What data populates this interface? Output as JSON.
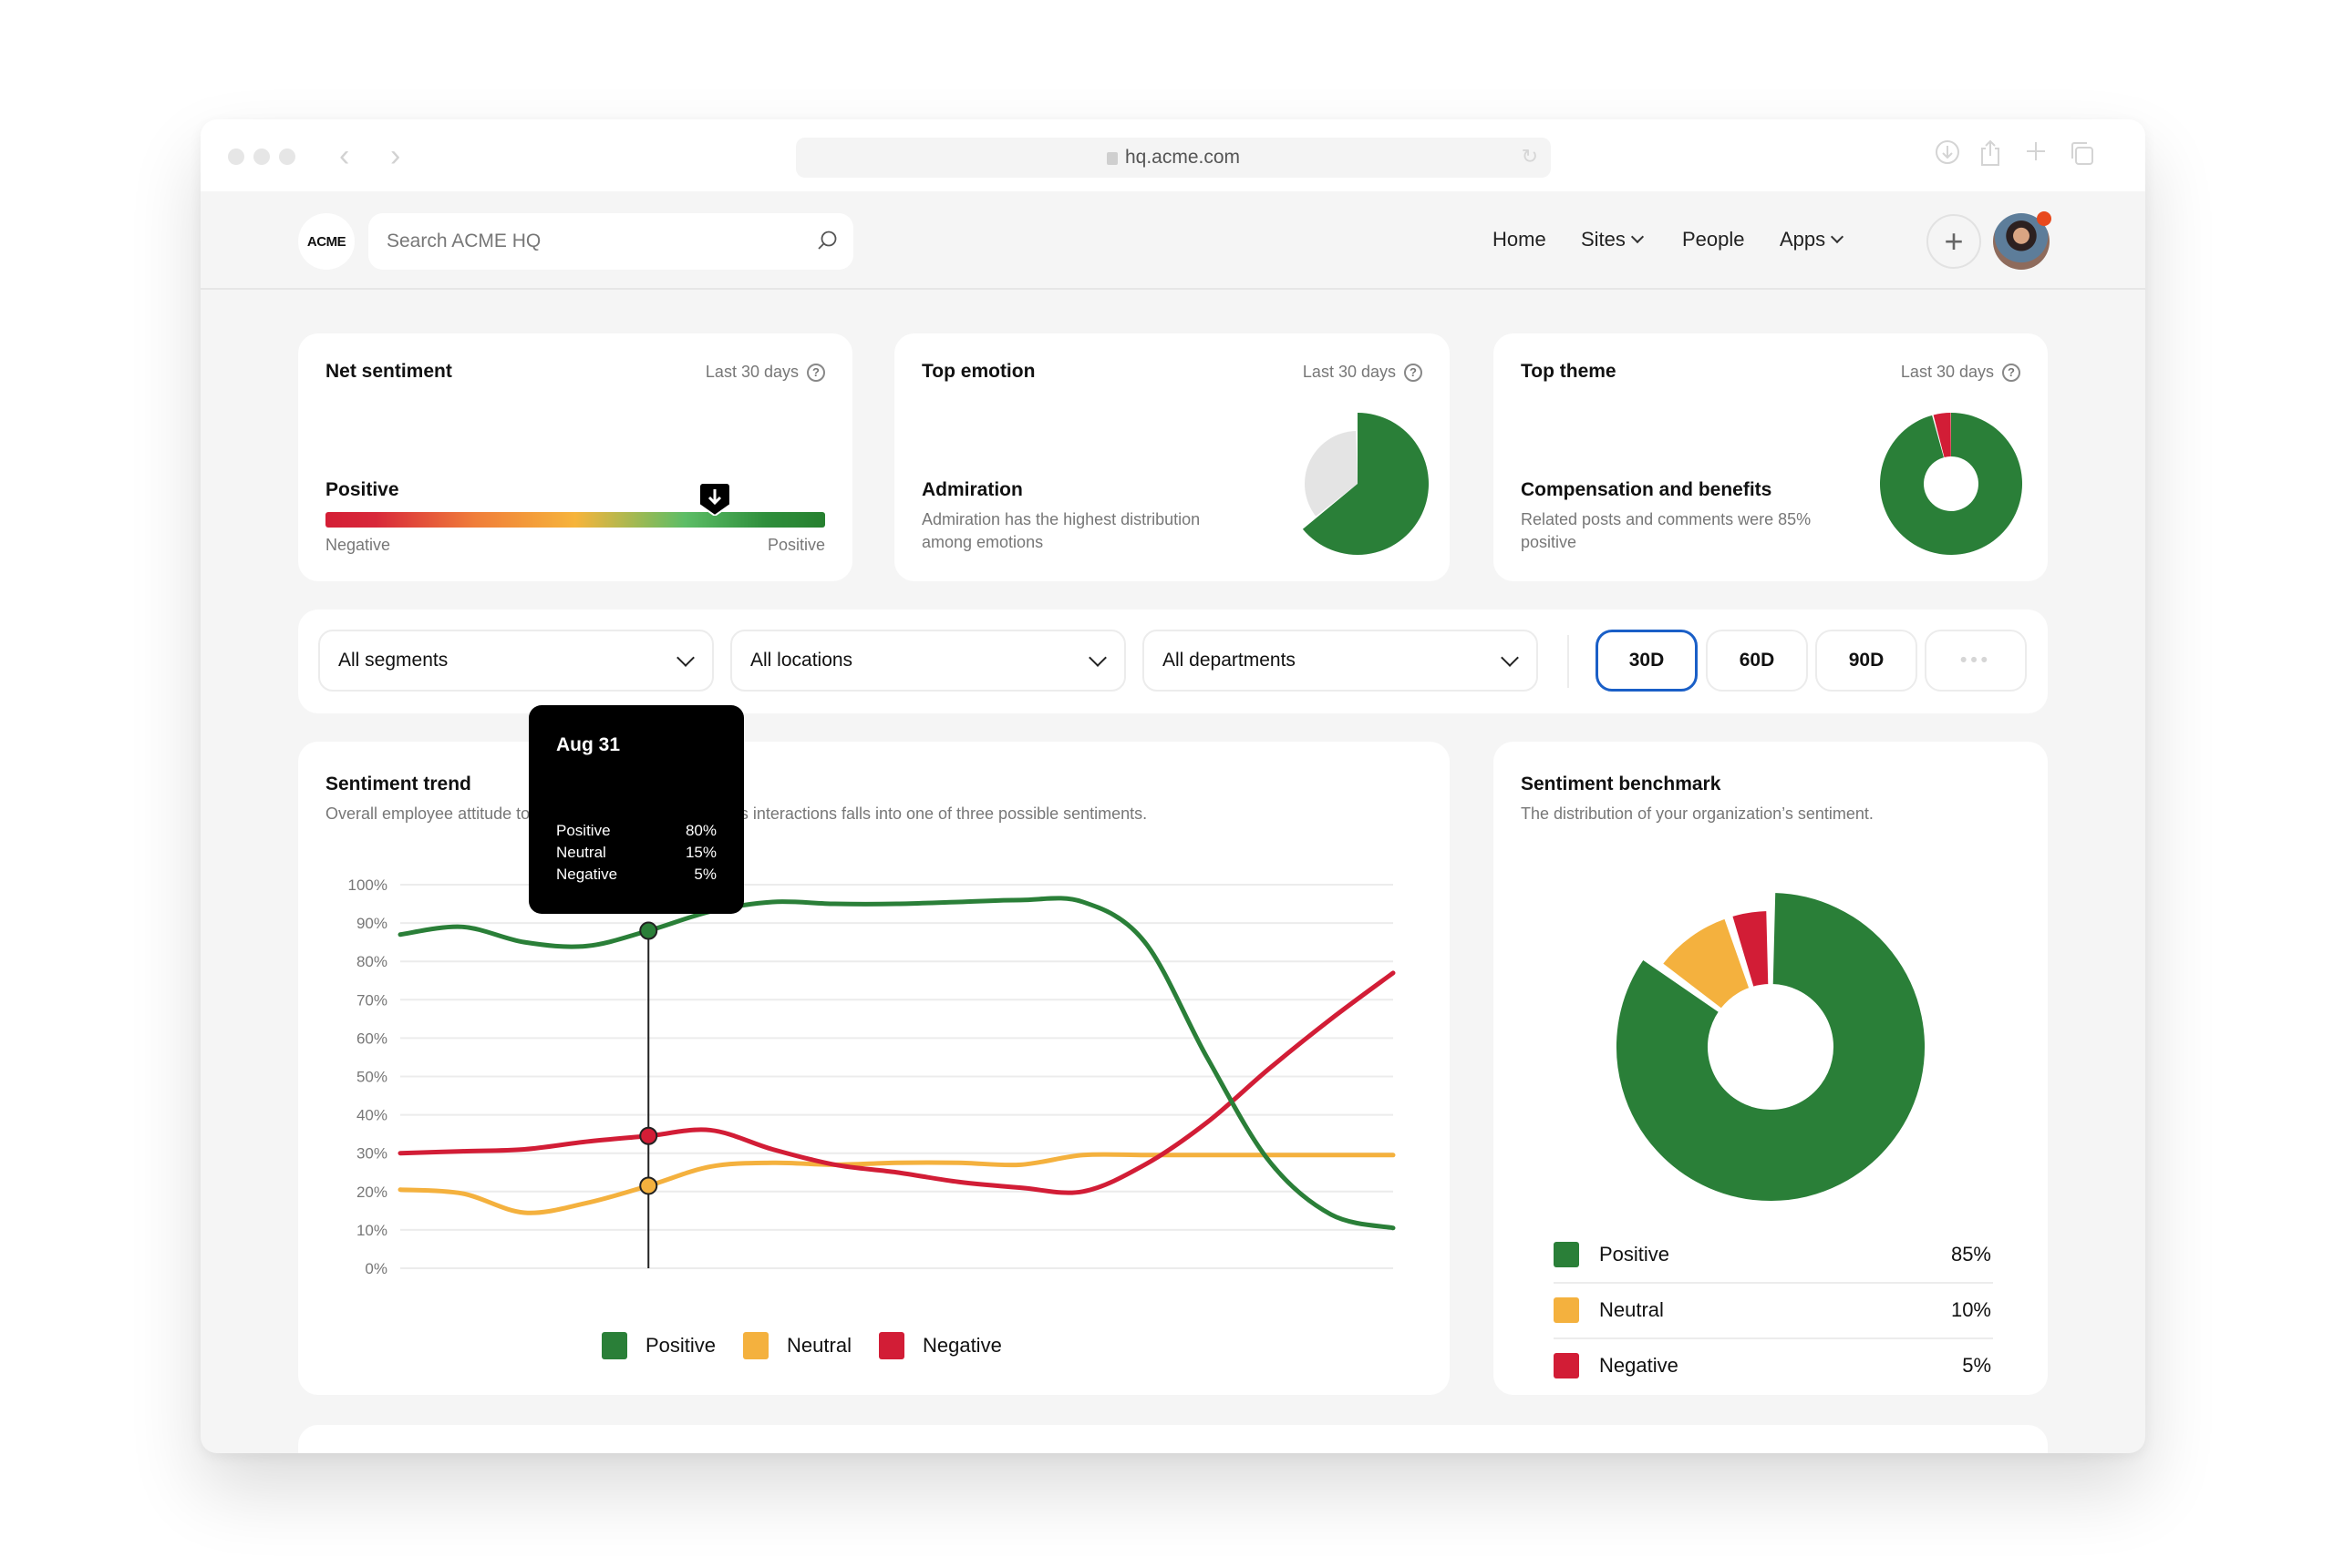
{
  "browser": {
    "url": "hq.acme.com"
  },
  "appbar": {
    "logo": "ACME",
    "search_placeholder": "Search ACME HQ",
    "nav": [
      {
        "label": "Home",
        "has_menu": false
      },
      {
        "label": "Sites",
        "has_menu": true
      },
      {
        "label": "People",
        "has_menu": false
      },
      {
        "label": "Apps",
        "has_menu": true
      }
    ],
    "create_label": "+",
    "notification_badge": true
  },
  "kpis": {
    "net_sentiment": {
      "title": "Net sentiment",
      "period": "Last 30 days",
      "value": "Positive",
      "gauge_position": 0.78,
      "min_label": "Negative",
      "max_label": "Positive"
    },
    "top_emotion": {
      "title": "Top emotion",
      "period": "Last 30 days",
      "value": "Admiration",
      "description": "Admiration has the highest distribution among emotions",
      "pie_share": 0.64
    },
    "top_theme": {
      "title": "Top theme",
      "period": "Last 30 days",
      "value": "Compensation and benefits",
      "description": "Related posts and comments were 85% positive",
      "donut_positive_share": 0.96,
      "donut_negative_share": 0.04
    }
  },
  "filters": {
    "segments": "All segments",
    "locations": "All locations",
    "departments": "All departments",
    "ranges": [
      "30D",
      "60D",
      "90D"
    ],
    "active_range": "30D",
    "more_label": "•••"
  },
  "colors": {
    "positive": "#2a7f38",
    "neutral": "#f4b13e",
    "negative": "#d21d36",
    "accent": "#1a5fc7"
  },
  "trend": {
    "title": "Sentiment trend",
    "subtitle": "Overall employee attitude toward the company. Each of its interactions falls into one of three possible sentiments.",
    "tooltip": {
      "date": "Aug 31",
      "rows": [
        {
          "label": "Positive",
          "value": "80%"
        },
        {
          "label": "Neutral",
          "value": "15%"
        },
        {
          "label": "Negative",
          "value": "5%"
        }
      ]
    }
  },
  "benchmark": {
    "title": "Sentiment benchmark",
    "subtitle": "The distribution of your organization’s sentiment.",
    "rows": [
      {
        "label": "Positive",
        "value": "85%"
      },
      {
        "label": "Neutral",
        "value": "10%"
      },
      {
        "label": "Negative",
        "value": "5%"
      }
    ]
  },
  "chart_data": [
    {
      "type": "line",
      "title": "Sentiment trend",
      "xlabel": "",
      "ylabel": "",
      "ylim": [
        0,
        100
      ],
      "yticks": [
        "0%",
        "10%",
        "20%",
        "30%",
        "40%",
        "50%",
        "60%",
        "70%",
        "80%",
        "90%",
        "100%"
      ],
      "grid": true,
      "legend": "bottom",
      "x": [
        0,
        1,
        2,
        3,
        4,
        5,
        6,
        7,
        8,
        9,
        10,
        11,
        12,
        13,
        14,
        15,
        16
      ],
      "hover_index": 4,
      "series": [
        {
          "name": "Positive",
          "color": "#2a7f38",
          "values": [
            87,
            89,
            85,
            84,
            88,
            93,
            95.5,
            95,
            95,
            95.5,
            96,
            95.5,
            85,
            55,
            28,
            14,
            10.5
          ]
        },
        {
          "name": "Neutral",
          "color": "#f4b13e",
          "values": [
            20.5,
            19.5,
            14.5,
            17,
            21.5,
            26.5,
            27.5,
            27,
            27.5,
            27.5,
            27,
            29.5,
            29.5,
            29.5,
            29.5,
            29.5,
            29.5
          ]
        },
        {
          "name": "Negative",
          "color": "#d21d36",
          "values": [
            30,
            30.5,
            31,
            33,
            34.5,
            36,
            31,
            27,
            25,
            22.5,
            21,
            20,
            27,
            38,
            52,
            65,
            77
          ]
        }
      ]
    },
    {
      "type": "pie",
      "title": "Sentiment benchmark",
      "donut": true,
      "legend": "bottom",
      "categories": [
        "Positive",
        "Neutral",
        "Negative"
      ],
      "values": [
        85,
        10,
        5
      ]
    }
  ]
}
